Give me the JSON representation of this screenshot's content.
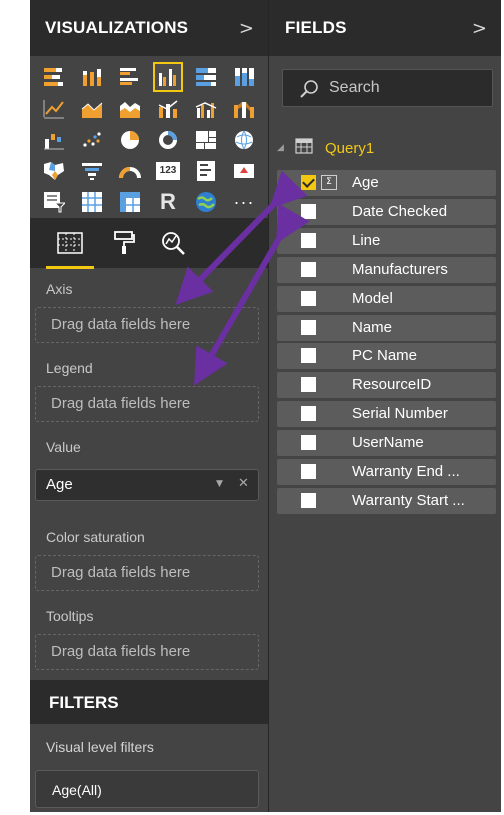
{
  "visualizations": {
    "title": "VISUALIZATIONS",
    "chevron": ">",
    "gallery_icons": [
      "stacked-bar-chart-icon",
      "stacked-column-chart-icon",
      "clustered-bar-chart-icon",
      "clustered-column-chart-icon",
      "100-percent-stacked-bar-chart-icon",
      "100-percent-stacked-column-chart-icon",
      "line-chart-icon",
      "area-chart-icon",
      "stacked-area-chart-icon",
      "line-and-stacked-column-chart-icon",
      "line-and-clustered-column-chart-icon",
      "ribbon-chart-icon",
      "waterfall-chart-icon",
      "scatter-chart-icon",
      "pie-chart-icon",
      "donut-chart-icon",
      "treemap-icon",
      "map-icon",
      "filled-map-icon",
      "funnel-icon",
      "gauge-icon",
      "card-icon",
      "multi-row-card-icon",
      "kpi-icon",
      "slicer-icon",
      "table-icon",
      "matrix-icon",
      "r-script-visual-icon",
      "arcgis-map-icon",
      "more-visuals-icon"
    ],
    "r_label": "R",
    "card_label": "123",
    "more_label": "···",
    "tabs": [
      "fields-tab-icon",
      "format-paint-roller-icon",
      "analytics-magnifier-icon"
    ],
    "wells": {
      "axis": {
        "label": "Axis",
        "placeholder": "Drag data fields here"
      },
      "legend": {
        "label": "Legend",
        "placeholder": "Drag data fields here"
      },
      "value": {
        "label": "Value",
        "field": "Age"
      },
      "color_saturation": {
        "label": "Color saturation",
        "placeholder": "Drag data fields here"
      },
      "tooltips": {
        "label": "Tooltips",
        "placeholder": "Drag data fields here"
      }
    },
    "filters": {
      "title": "FILTERS",
      "visual_level_label": "Visual level filters",
      "filter_pill": "Age(All)"
    }
  },
  "fields_pane": {
    "title": "FIELDS",
    "chevron": ">",
    "search_placeholder": "Search",
    "table": {
      "name": "Query1",
      "expand_glyph": "◢"
    },
    "fields": [
      {
        "name": "Age",
        "checked": true,
        "sigma": "Σ"
      },
      {
        "name": "Date Checked",
        "checked": false
      },
      {
        "name": "Line",
        "checked": false
      },
      {
        "name": "Manufacturers",
        "checked": false
      },
      {
        "name": "Model",
        "checked": false
      },
      {
        "name": "Name",
        "checked": false
      },
      {
        "name": "PC Name",
        "checked": false
      },
      {
        "name": "ResourceID",
        "checked": false
      },
      {
        "name": "Serial Number",
        "checked": false
      },
      {
        "name": "UserName",
        "checked": false
      },
      {
        "name": "Warranty End ...",
        "checked": false
      },
      {
        "name": "Warranty Start ...",
        "checked": false
      }
    ]
  },
  "colors": {
    "accent_yellow": "#f2c811",
    "annotation_purple": "#6a2fa0",
    "pane_bg": "#444444",
    "header_bg": "#2b2b2b"
  }
}
